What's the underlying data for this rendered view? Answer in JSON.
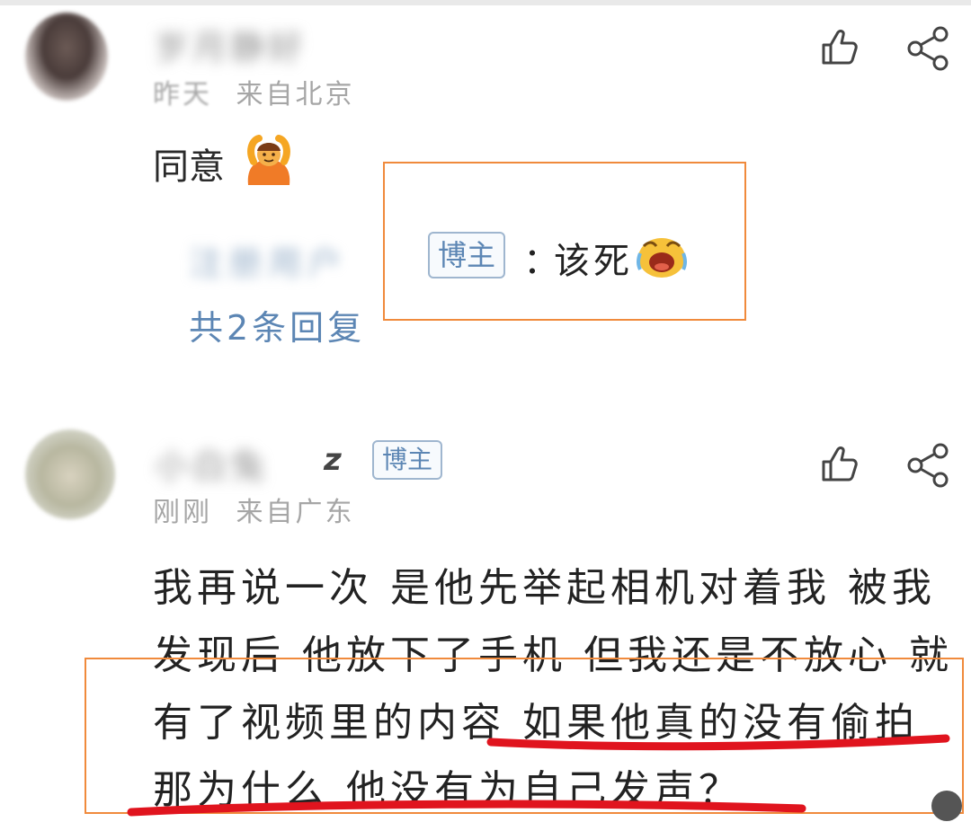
{
  "comment1": {
    "author_name": "岁月静好",
    "time": "昨天",
    "location": "来自北京",
    "text": "同意",
    "reply": {
      "author_name": "注册用户",
      "tag": "博主",
      "colon": "：",
      "text": "该死"
    },
    "reply_count": "共2条回复"
  },
  "comment2": {
    "author_name": "小白兔",
    "name_suffix": "z",
    "tag": "博主",
    "time": "刚刚",
    "location": "来自广东",
    "lines": [
      "我再说一次 是他先举起相机对着我 被我",
      "发现后 他放下了手机 但我还是不放心 就",
      "有了视频里的内容 如果他真的没有偷拍",
      "那为什么 他没有为自己发声？"
    ]
  },
  "icons": {
    "like": "thumbs-up-icon",
    "share": "share-icon",
    "emoji_gesture": "person-gesturing-ok-emoji",
    "emoji_cry": "crying-face-emoji"
  },
  "colors": {
    "tag_blue": "#5c86b4",
    "highlight_orange": "#f08a3c",
    "underline_red": "#e0141e"
  }
}
